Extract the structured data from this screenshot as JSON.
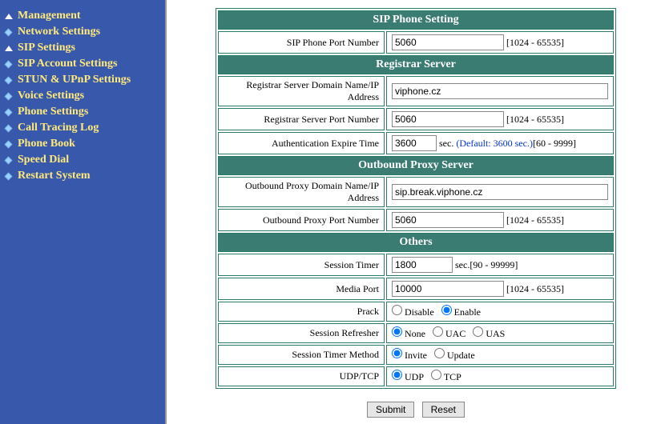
{
  "sidebar": {
    "items": [
      {
        "label": "Management",
        "expanded": true
      },
      {
        "label": "Network Settings",
        "expanded": false
      },
      {
        "label": "SIP Settings",
        "expanded": true
      },
      {
        "label": "SIP Account Settings",
        "expanded": false
      },
      {
        "label": "STUN & UPnP Settings",
        "expanded": false
      },
      {
        "label": "Voice Settings",
        "expanded": false
      },
      {
        "label": "Phone Settings",
        "expanded": false
      },
      {
        "label": "Call Tracing Log",
        "expanded": false
      },
      {
        "label": "Phone Book",
        "expanded": false
      },
      {
        "label": "Speed Dial",
        "expanded": false
      },
      {
        "label": "Restart System",
        "expanded": false
      }
    ]
  },
  "sections": {
    "sip": {
      "title": "SIP Phone Setting"
    },
    "reg": {
      "title": "Registrar Server"
    },
    "proxy": {
      "title": "Outbound Proxy Server"
    },
    "others": {
      "title": "Others"
    }
  },
  "fields": {
    "sip_port_label": "SIP Phone Port Number",
    "sip_port_value": "5060",
    "sip_port_hint": "[1024 - 65535]",
    "reg_domain_label": "Registrar Server Domain Name/IP Address",
    "reg_domain_value": "viphone.cz",
    "reg_port_label": "Registrar Server Port Number",
    "reg_port_value": "5060",
    "reg_port_hint": "[1024 - 65535]",
    "auth_exp_label": "Authentication Expire Time",
    "auth_exp_value": "3600",
    "auth_exp_sec": "sec.",
    "auth_exp_default": "(Default: 3600 sec.)",
    "auth_exp_range": "[60 - 9999]",
    "proxy_domain_label": "Outbound Proxy Domain Name/IP Address",
    "proxy_domain_value": "sip.break.viphone.cz",
    "proxy_port_label": "Outbound Proxy Port Number",
    "proxy_port_value": "5060",
    "proxy_port_hint": "[1024 - 65535]",
    "session_timer_label": "Session Timer",
    "session_timer_value": "1800",
    "session_timer_hint": "sec.[90 - 99999]",
    "media_port_label": "Media Port",
    "media_port_value": "10000",
    "media_port_hint": "[1024 - 65535]",
    "prack_label": "Prack",
    "prack_disable": "Disable",
    "prack_enable": "Enable",
    "refresher_label": "Session Refresher",
    "refresher_none": "None",
    "refresher_uac": "UAC",
    "refresher_uas": "UAS",
    "timer_method_label": "Session Timer Method",
    "timer_method_invite": "Invite",
    "timer_method_update": "Update",
    "udptcp_label": "UDP/TCP",
    "udptcp_udp": "UDP",
    "udptcp_tcp": "TCP"
  },
  "buttons": {
    "submit": "Submit",
    "reset": "Reset"
  }
}
